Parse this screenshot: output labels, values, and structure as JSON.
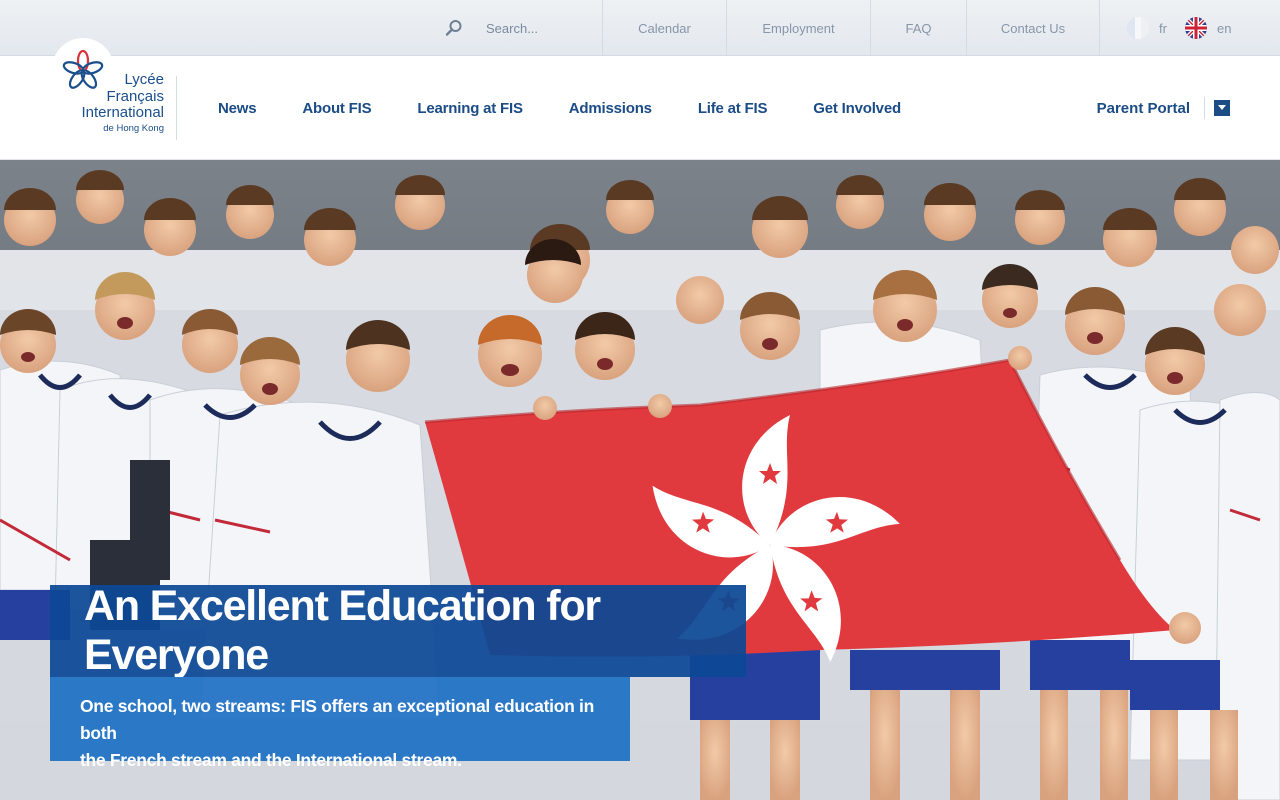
{
  "utility": {
    "search_placeholder": "Search...",
    "links": [
      "Calendar",
      "Employment",
      "FAQ",
      "Contact Us"
    ],
    "languages": [
      {
        "code": "fr",
        "flag": "france-flag-icon"
      },
      {
        "code": "en",
        "flag": "uk-flag-icon"
      }
    ]
  },
  "logo": {
    "line1": "Lycée",
    "line2": "Français",
    "line3": "International",
    "line4": "de Hong Kong"
  },
  "nav": {
    "items": [
      "News",
      "About FIS",
      "Learning at FIS",
      "Admissions",
      "Life at FIS",
      "Get Involved"
    ],
    "parent_portal": "Parent Portal"
  },
  "hero": {
    "title": "An Excellent Education for Everyone",
    "subtitle_line1": "One school, two streams: FIS offers an exceptional education in both",
    "subtitle_line2": "the French stream and the International stream."
  },
  "colors": {
    "brand_blue": "#1b4c86",
    "hero_title_bg": "#0c4896",
    "hero_sub_bg": "#1e70c4",
    "flag_red": "#e03a3e"
  }
}
